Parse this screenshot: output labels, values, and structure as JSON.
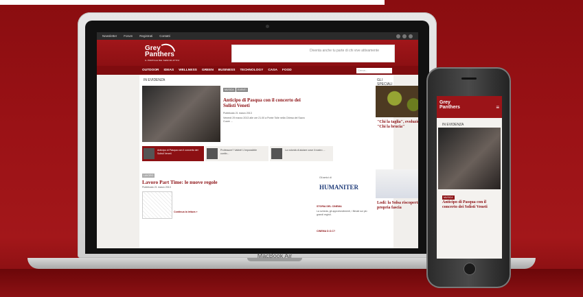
{
  "laptop": {
    "brand": "MacBook Air"
  },
  "site": {
    "topbar": [
      "Newsletter",
      "Forum",
      "Registrati",
      "Contatti"
    ],
    "logo": {
      "line1": "Grey",
      "line2": "Panthers",
      "tagline": "IL PORTALE DEI SENIOR ATTIVI"
    },
    "ad_text": "Diventa anche tu parte di chi vive attivamente",
    "nav": [
      "OUTDOOR",
      "IDEAS",
      "WELLNESS",
      "GREEN",
      "BUSINESS",
      "TECHNOLOGY",
      "CASA",
      "FOOD"
    ],
    "search_placeholder": "Cerca...",
    "in_evidenza": "IN EVIDENZA",
    "speciali": "GLI SPECIALI",
    "featured": {
      "tags": [
        "MUSICA",
        "EVENTI"
      ],
      "title": "Anticipo di Pasqua con il concerto dei Solisti Veneti",
      "meta": "Pubblicato 21 marzo 2013",
      "excerpt": "Venerdì 29 marzo 2013 alle ore 21.00 a Ponte Tolle nella Chiesa del Sacro Cuore ..."
    },
    "strip": [
      {
        "text": "Anticipo di Pasqua con il concerto dei Solisti Veneti"
      },
      {
        "text": "Professore? Vabbè! L'impossibile confin..."
      },
      {
        "text": "La volontà di aiutare cose il nostro ..."
      }
    ],
    "section2": {
      "tag": "LAVORO",
      "title": "Lavoro Part Time: le nuove regole",
      "meta": "Pubblicato 21 marzo 2013",
      "link": "Continua la lettura »"
    },
    "partner": {
      "caption": "Gli amici di",
      "name": "HUMANITER"
    },
    "partner_items": [
      {
        "title": "STORIA DEL CINEMA",
        "text": "La scheda, gli approfondimenti, i filmati sui più grandi registi."
      },
      {
        "title": "CINEMA D.O.C?"
      }
    ],
    "speciali_items": [
      {
        "title": "\"Chi la taglia\", evoluzione di \"Chi la brucia\""
      },
      {
        "title": "Lodi: la Solsa riscoperta della propria fascia"
      }
    ]
  },
  "phone": {
    "section": "IN EVIDENZA",
    "tag": "MUSICA",
    "title": "Anticipo di Pasqua con il concerto dei Solisti Veneti",
    "menu_icon": "≡"
  }
}
